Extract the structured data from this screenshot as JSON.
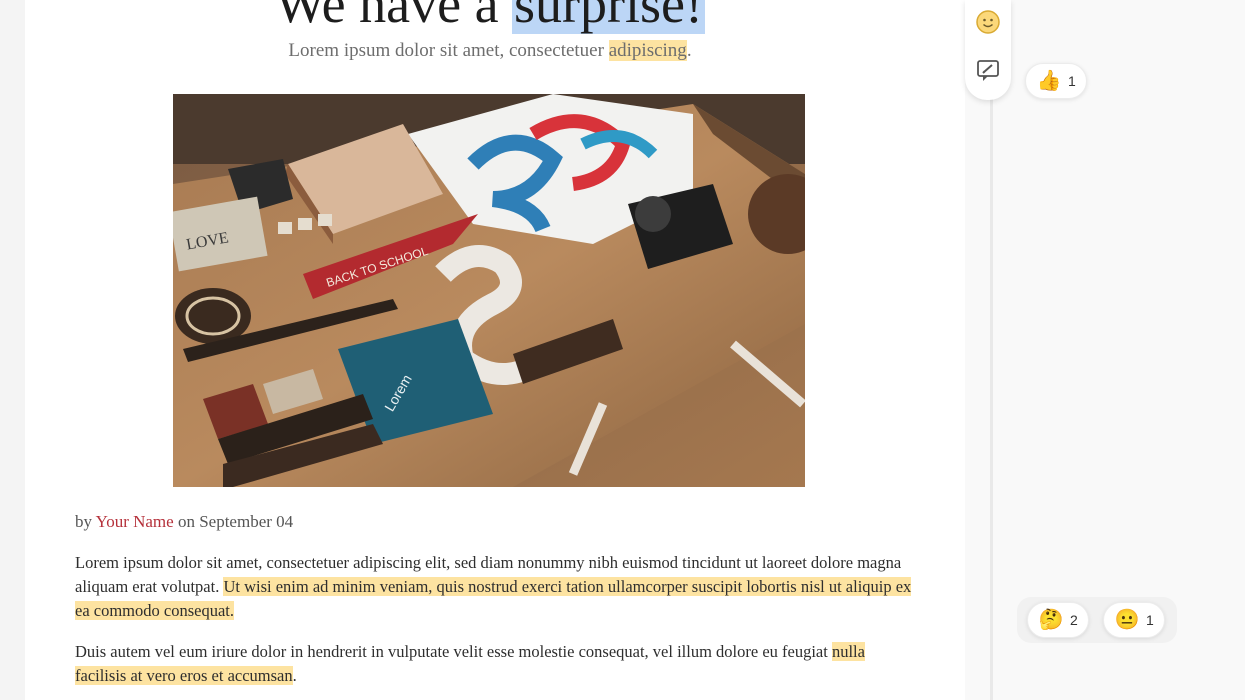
{
  "article": {
    "title_start": "We have a ",
    "title_highlight": "surprise!",
    "subtitle_start": "Lorem ipsum dolor sit amet, consectetuer ",
    "subtitle_highlight": "adipiscing",
    "subtitle_end": ".",
    "byline_by": "by",
    "author": "Your Name",
    "byline_on": "on September 04",
    "para1_plain": "Lorem ipsum dolor sit amet, consectetuer adipiscing elit, sed diam nonummy nibh euismod tincidunt ut laoreet dolore magna aliquam erat volutpat. ",
    "para1_highlight": "Ut wisi enim ad minim veniam, quis nostrud exerci tation ullamcorper suscipit lobortis nisl ut aliquip ex ea commodo consequat.",
    "para2_plain": "Duis autem vel eum iriure dolor in hendrerit in vulputate velit esse molestie consequat, vel illum dolore eu feugiat ",
    "para2_highlight": "nulla facilisis at vero eros et accumsan",
    "para2_end": "."
  },
  "tools": {
    "emoji_icon": "smile-icon",
    "comment_icon": "comment-edit-icon"
  },
  "reactions": {
    "top": [
      {
        "emoji": "👍",
        "icon": "thumbs-up-icon",
        "count": "1"
      }
    ],
    "bottom": [
      {
        "emoji": "🤔",
        "icon": "thinking-face-icon",
        "count": "2"
      },
      {
        "emoji": "😐",
        "icon": "neutral-face-icon",
        "count": "1"
      }
    ]
  },
  "colors": {
    "highlight_yellow": "#fde3a1",
    "selection_blue": "#bcd6f6",
    "author_red": "#b5313b"
  }
}
